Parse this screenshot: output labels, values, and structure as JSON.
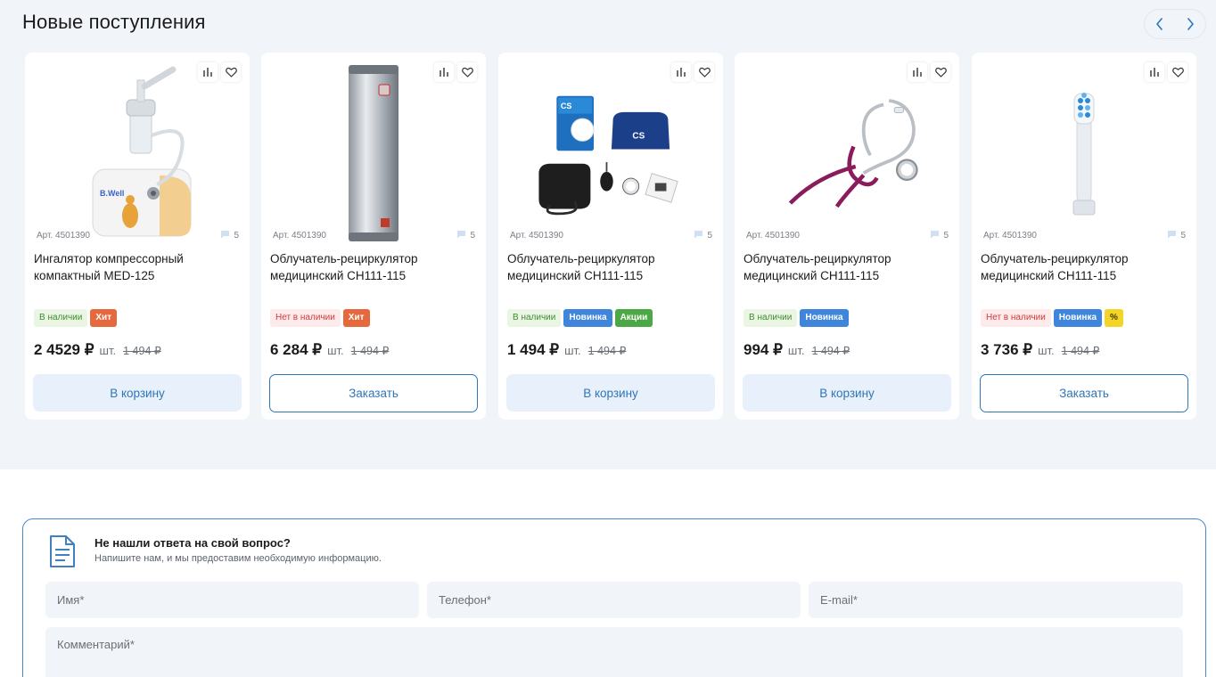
{
  "section": {
    "title": "Новые поступления"
  },
  "products": [
    {
      "article": "Арт. 4501390",
      "reviews": "5",
      "name": "Ингалятор компрессорный компактный MED-125",
      "badges": [
        {
          "text": "В наличии",
          "kind": "in"
        },
        {
          "text": "Хит",
          "kind": "hit"
        }
      ],
      "price": "2 4529 ₽",
      "unit": "шт.",
      "old_price": "1 494 ₽",
      "button": "В корзину",
      "button_kind": "cart",
      "image": "nebulizer"
    },
    {
      "article": "Арт. 4501390",
      "reviews": "5",
      "name": "Облучатель-рециркулятор медицинский СН111-115",
      "badges": [
        {
          "text": "Нет в наличии",
          "kind": "out"
        },
        {
          "text": "Хит",
          "kind": "hit"
        }
      ],
      "price": "6 284 ₽",
      "unit": "шт.",
      "old_price": "1 494 ₽",
      "button": "Заказать",
      "button_kind": "order",
      "image": "recirculator"
    },
    {
      "article": "Арт. 4501390",
      "reviews": "5",
      "name": "Облучатель-рециркулятор медицинский СН111-115",
      "badges": [
        {
          "text": "В наличии",
          "kind": "in"
        },
        {
          "text": "Новинка",
          "kind": "new"
        },
        {
          "text": "Акции",
          "kind": "sale"
        }
      ],
      "price": "1 494 ₽",
      "unit": "шт.",
      "old_price": "1 494 ₽",
      "button": "В корзину",
      "button_kind": "cart",
      "image": "tonometer-kit"
    },
    {
      "article": "Арт. 4501390",
      "reviews": "5",
      "name": "Облучатель-рециркулятор медицинский СН111-115",
      "badges": [
        {
          "text": "В наличии",
          "kind": "in"
        },
        {
          "text": "Новинка",
          "kind": "new"
        }
      ],
      "price": "994 ₽",
      "unit": "шт.",
      "old_price": "1 494 ₽",
      "button": "В корзину",
      "button_kind": "cart",
      "image": "stethoscope"
    },
    {
      "article": "Арт. 4501390",
      "reviews": "5",
      "name": "Облучатель-рециркулятор медицинский СН111-115",
      "badges": [
        {
          "text": "Нет в наличии",
          "kind": "out"
        },
        {
          "text": "Новинка",
          "kind": "new"
        },
        {
          "text": "%",
          "kind": "pct"
        }
      ],
      "price": "3 736 ₽",
      "unit": "шт.",
      "old_price": "1 494 ₽",
      "button": "Заказать",
      "button_kind": "order",
      "image": "toothbrush-head"
    }
  ],
  "form": {
    "title": "Не нашли ответа на свой вопрос?",
    "subtitle": "Напишите нам, и мы предоставим необходимую информацию.",
    "name_placeholder": "Имя*",
    "phone_placeholder": "Телефон*",
    "email_placeholder": "E-mail*",
    "comment_placeholder": "Комментарий*"
  },
  "icons": {
    "prev": "chevron-left-icon",
    "next": "chevron-right-icon",
    "compare": "compare-chart-icon",
    "favorite": "heart-icon",
    "reviews": "comment-icon",
    "form": "document-icon"
  },
  "colors": {
    "accent": "#2f76b8",
    "in_stock": "#3e8e2f",
    "out_of_stock": "#d23c3c",
    "hit": "#e6693e",
    "new": "#3f85dc",
    "sale": "#4ba845",
    "percent": "#f3d528"
  }
}
